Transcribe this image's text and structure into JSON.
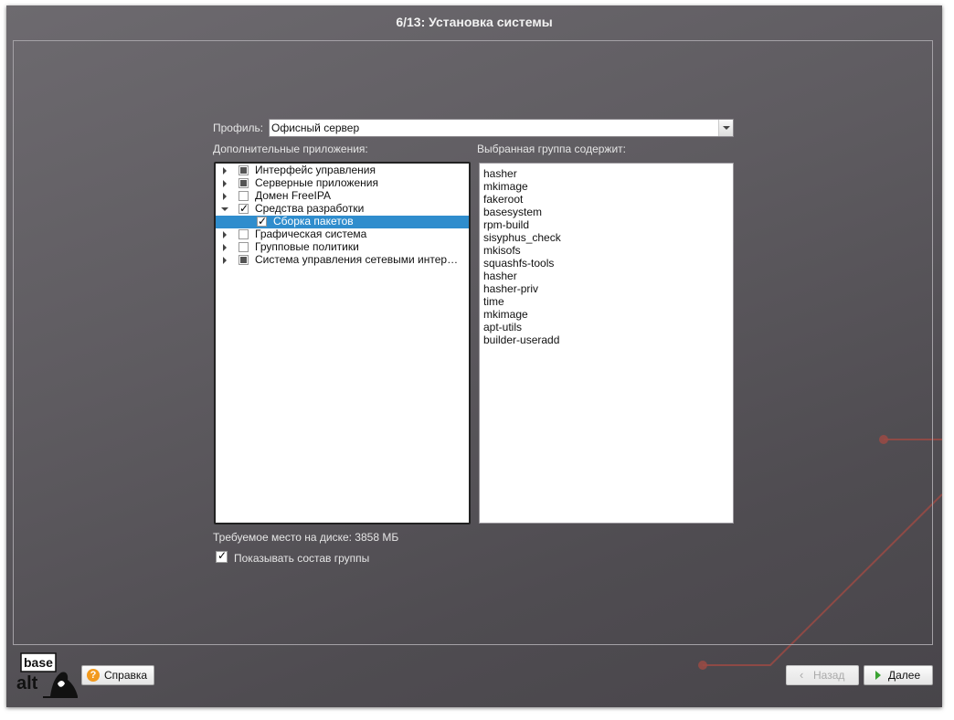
{
  "window": {
    "title": "6/13: Установка системы"
  },
  "profile": {
    "label": "Профиль:",
    "value": "Офисный сервер"
  },
  "apps": {
    "header": "Дополнительные приложения:",
    "items": [
      {
        "label": "Интерфейс управления",
        "state": "partial",
        "expander": "collapsed"
      },
      {
        "label": "Серверные приложения",
        "state": "partial",
        "expander": "collapsed"
      },
      {
        "label": "Домен FreeIPA",
        "state": "unchecked",
        "expander": "collapsed"
      },
      {
        "label": "Средства разработки",
        "state": "checked",
        "expander": "expanded"
      },
      {
        "label": "Сборка пакетов",
        "state": "checked",
        "expander": "none",
        "selected": true,
        "child": true
      },
      {
        "label": "Графическая система",
        "state": "unchecked",
        "expander": "collapsed"
      },
      {
        "label": "Групповые политики",
        "state": "unchecked",
        "expander": "collapsed"
      },
      {
        "label": "Система управления сетевыми интер…",
        "state": "partial",
        "expander": "collapsed"
      }
    ]
  },
  "group": {
    "header": "Выбранная группа содержит:",
    "packages": [
      "hasher",
      "mkimage",
      "fakeroot",
      "basesystem",
      "rpm-build",
      "sisyphus_check",
      "mkisofs",
      "squashfs-tools",
      "hasher",
      "hasher-priv",
      "time",
      "mkimage",
      "apt-utils",
      "builder-useradd"
    ]
  },
  "disk": {
    "text": "Требуемое место на диске: 3858 МБ"
  },
  "show_group": {
    "label": "Показывать состав группы",
    "checked": true
  },
  "footer": {
    "logo_text_top": "base",
    "logo_text_bottom": "alt",
    "help_label": "Справка",
    "back_label": "Назад",
    "next_label": "Далее"
  },
  "colors": {
    "selection": "#2f8dcd",
    "accent_line": "#b0443e",
    "help_icon": "#f29a1e"
  }
}
